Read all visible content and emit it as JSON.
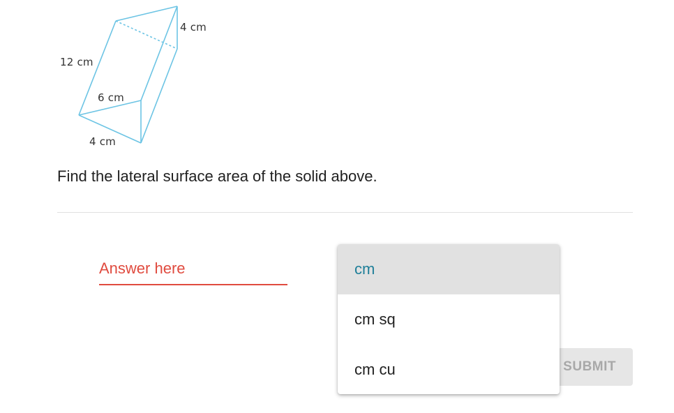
{
  "figure": {
    "labels": {
      "top_edge": "4 cm",
      "left_edge": "12 cm",
      "middle_edge": "6 cm",
      "bottom_edge": "4 cm"
    },
    "line_color": "#6cc4e4"
  },
  "question": "Find the lateral surface area of the solid above.",
  "answer": {
    "placeholder": "Answer here",
    "value": "",
    "accent_color": "#e04b3f"
  },
  "unit_menu": {
    "options": [
      "cm",
      "cm sq",
      "cm cu"
    ],
    "selected": "cm",
    "selected_color": "#1f7f99"
  },
  "submit": {
    "label": "SUBMIT",
    "enabled": false
  }
}
